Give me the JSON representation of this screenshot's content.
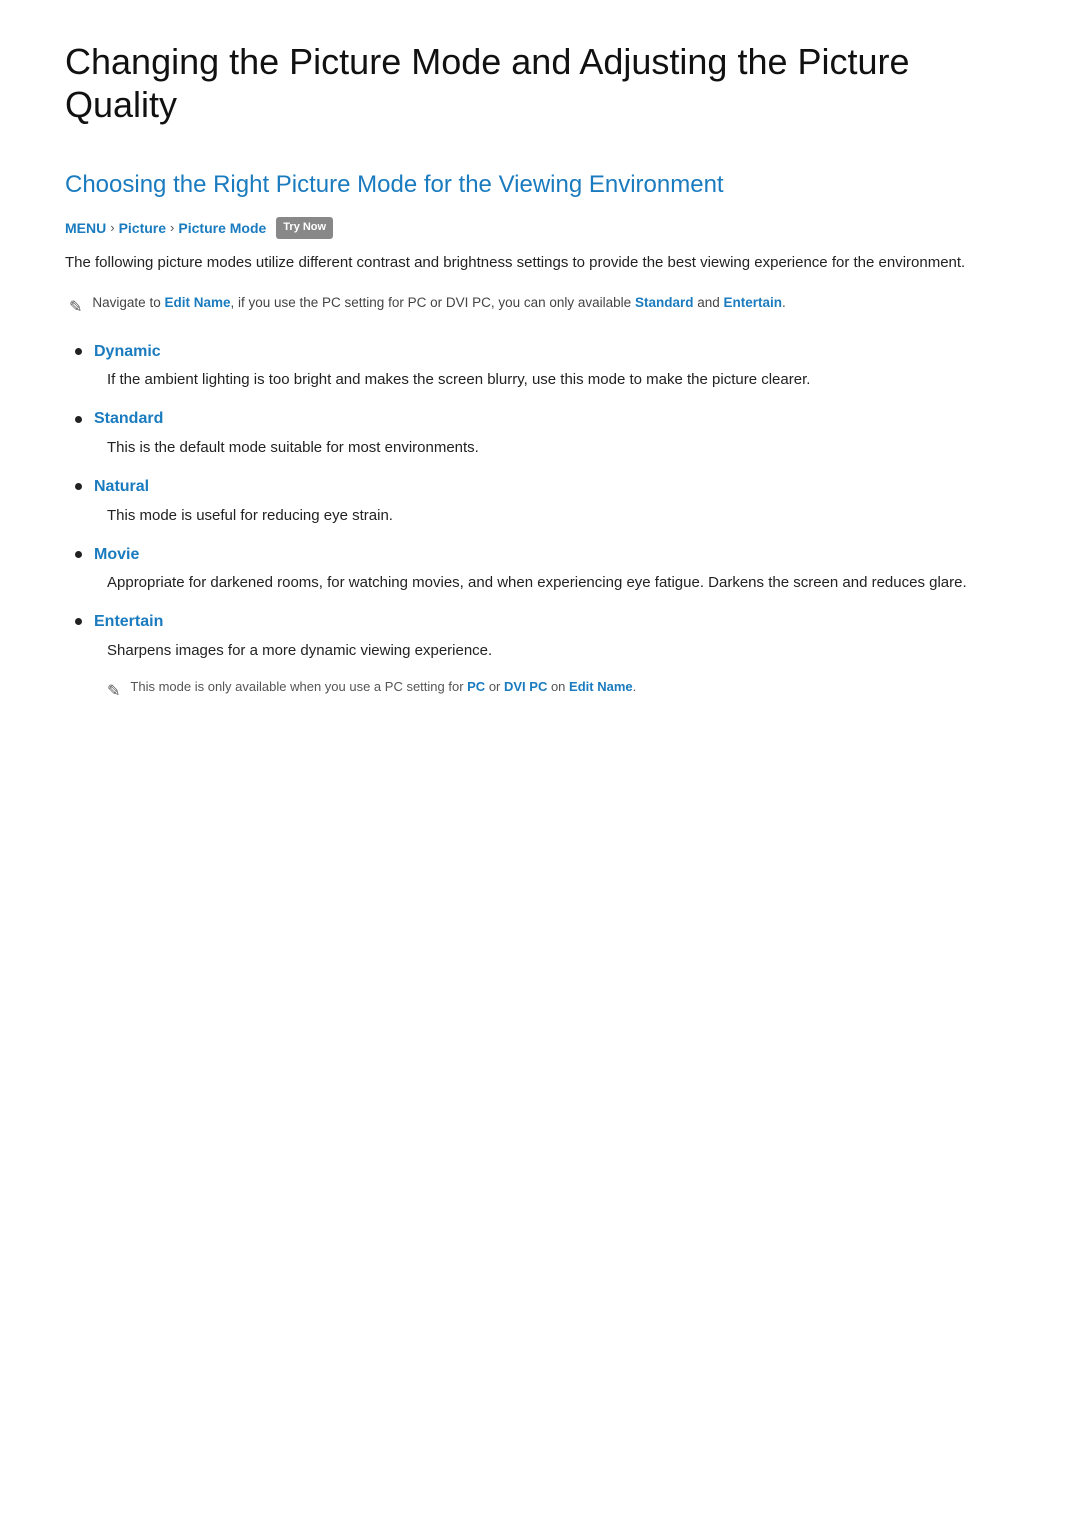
{
  "page": {
    "title_line1": "Changing the Picture Mode and Adjusting the Picture",
    "title_line2": "Quality"
  },
  "section": {
    "title": "Choosing the Right Picture Mode for the Viewing Environment"
  },
  "breadcrumb": {
    "items": [
      "MENU",
      "Picture",
      "Picture Mode"
    ],
    "separators": [
      ">",
      ">"
    ],
    "badge": "Try Now"
  },
  "intro": {
    "text": "The following picture modes utilize different contrast and brightness settings to provide the best viewing experience for the environment."
  },
  "note1": {
    "icon": "✎",
    "text_before": "Navigate to ",
    "link1": "Edit Name",
    "text_middle": ", if you use the PC setting for PC or DVI PC, you can only available ",
    "link2": "Standard",
    "text_and": " and",
    "link3": "Entertain",
    "text_after": "."
  },
  "modes": [
    {
      "name": "Dynamic",
      "description": "If the ambient lighting is too bright and makes the screen blurry, use this mode to make the picture clearer."
    },
    {
      "name": "Standard",
      "description": "This is the default mode suitable for most environments."
    },
    {
      "name": "Natural",
      "description": "This mode is useful for reducing eye strain."
    },
    {
      "name": "Movie",
      "description": "Appropriate for darkened rooms, for watching movies, and when experiencing eye fatigue. Darkens the screen and reduces glare."
    },
    {
      "name": "Entertain",
      "description": "Sharpens images for a more dynamic viewing experience."
    }
  ],
  "sub_note": {
    "icon": "✎",
    "text_before": "This mode is only available when you use a PC setting for ",
    "link1": "PC",
    "text_middle": " or ",
    "link2": "DVI PC",
    "text_after": " on ",
    "link3": "Edit Name",
    "text_end": "."
  }
}
